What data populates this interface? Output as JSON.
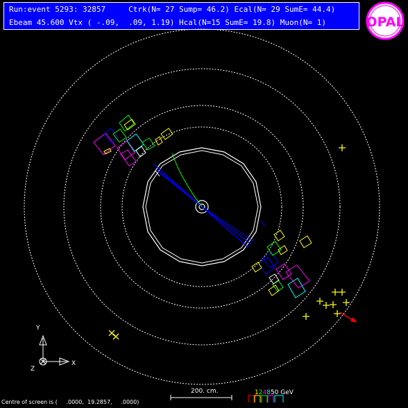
{
  "header": {
    "line1": "Run:event 5293: 32857     Ctrk(N= 27 Sump= 46.2) Ecal(N= 29 SumE= 44.4)",
    "line2": "Ebeam 45.600 Vtx ( -.09,  .09, 1.19) Hcal(N=15 SumE= 19.8) Muon(N= 1)"
  },
  "logo": {
    "text": "OPAL",
    "colors": {
      "ring": "#ff00ff",
      "fill": "#ffffff"
    }
  },
  "axes": {
    "y_label": "Y",
    "x_label": "X",
    "z_label": "Z"
  },
  "scale": {
    "label": "200. cm."
  },
  "energy_legend": {
    "values": [
      "1",
      "2",
      "4",
      "8",
      "50 GeV"
    ],
    "colors": [
      "#ffff00",
      "#00ff00",
      "#ff00ff",
      "#00ffff",
      "#ffffff"
    ]
  },
  "footer": {
    "centre": "Centre of screen is (     .0000,  19.2857,     .0000)"
  },
  "colors": {
    "background": "#000000",
    "header_bg": "#0000ff",
    "tracks": "#0000ff",
    "track_green": "#00ff00",
    "hcal": "#ffff00",
    "muon_arrow": "#ff0000"
  }
}
